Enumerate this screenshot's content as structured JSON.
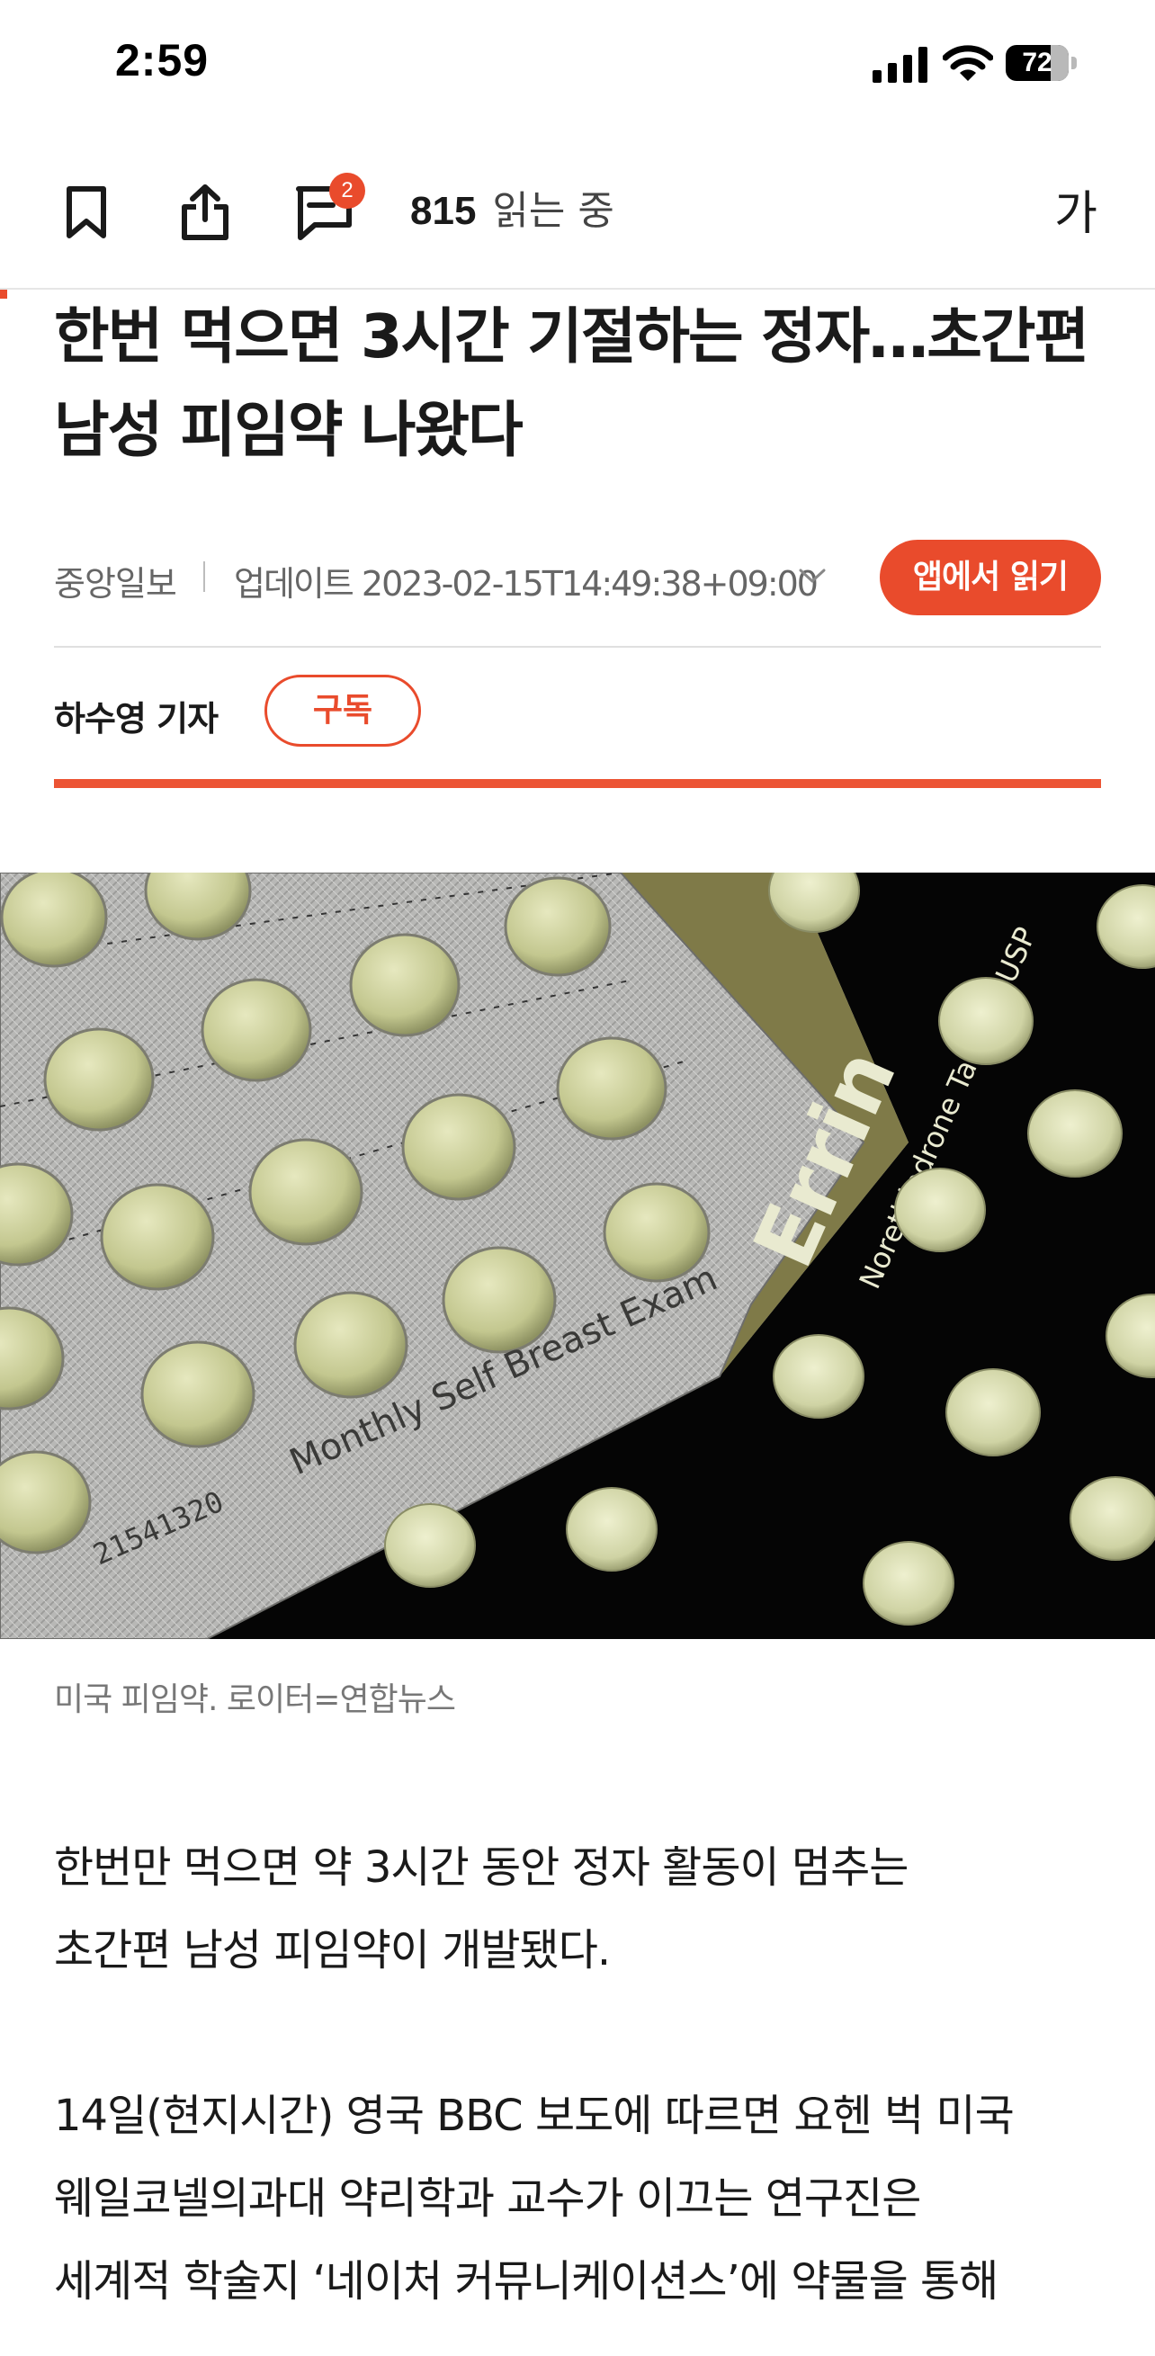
{
  "status_bar": {
    "time": "2:59",
    "battery": "72",
    "battery_level": 0.72,
    "icons": [
      "signal-icon",
      "wifi-icon",
      "battery-icon"
    ]
  },
  "toolbar": {
    "comment_count": "2",
    "readers_count": "815",
    "readers_label": "읽는 중",
    "font_size_label": "가",
    "icons": [
      "bookmark-icon",
      "share-icon",
      "comment-icon"
    ]
  },
  "article": {
    "headline": "한번 먹으면 3시간 기절하는 정자…초간편 남성 피임약 나왔다",
    "publisher": "중앙일보",
    "updated": "업데이트 2023-02-15T14:49:38+09:00",
    "open_in_app": "앱에서 읽기",
    "author": "하수영 기자",
    "subscribe": "구독",
    "photo": {
      "printed_text": [
        "Errin",
        "Norethindrone Tablets, USP",
        "Monthly Self Breast Exam",
        "21541320"
      ]
    },
    "caption": "미국 피임약. 로이터=연합뉴스",
    "paragraphs": [
      [
        " 한번만 먹으면 약 3시간 동안 정자 활동이 멈추는",
        "초간편 남성 피임약이 개발됐다."
      ],
      [
        "14일(현지시간) 영국 BBC 보도에 따르면 요헨 벅 미국",
        "웨일코넬의과대 약리학과 교수가 이끄는 연구진은",
        "세계적 학술지 ‘네이처 커뮤니케이션스’에 약물을 통해"
      ]
    ]
  },
  "colors": {
    "accent": "#e94b2c",
    "text": "#1a1a1a",
    "muted": "#666666",
    "photo_background": "#050505"
  }
}
